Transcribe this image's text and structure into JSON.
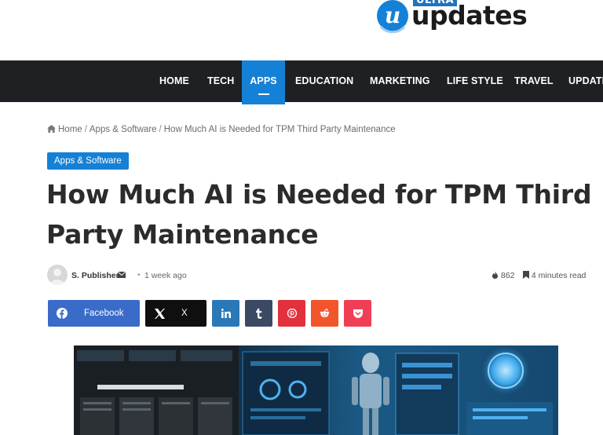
{
  "logo": {
    "ultra": "ULTRA",
    "updates": "updates",
    "mark": "u"
  },
  "nav": {
    "items": [
      {
        "label": "HOME",
        "active": false
      },
      {
        "label": "TECH",
        "active": false
      },
      {
        "label": "APPS",
        "active": true
      },
      {
        "label": "EDUCATION",
        "active": false
      },
      {
        "label": "MARKETING",
        "active": false
      },
      {
        "label": "LIFE STYLE",
        "active": false
      },
      {
        "label": "TRAVEL",
        "active": false
      },
      {
        "label": "UPDATE",
        "active": false
      }
    ]
  },
  "breadcrumb": {
    "home": "Home",
    "category": "Apps & Software",
    "current": "How Much AI is Needed for TPM Third Party Maintenance",
    "separator": "/"
  },
  "article": {
    "category_badge": "Apps & Software",
    "title": "How Much AI is Needed for TPM Third Party Maintenance",
    "author": "S. Publisher",
    "date": "1 week ago",
    "views": "862",
    "read_time": "4 minutes read"
  },
  "share": {
    "facebook": "Facebook",
    "x": "X"
  },
  "colors": {
    "accent": "#1581d6",
    "nav_bg": "#1f2024",
    "facebook": "#3a6bc9",
    "x": "#0f0f0f",
    "linkedin": "#2a78b8",
    "tumblr": "#3b4a63",
    "pinterest": "#e2313c",
    "reddit": "#f2542b",
    "pocket": "#ef3f56"
  },
  "icons": {
    "home": "home-icon",
    "mail": "envelope-icon",
    "views": "fire-icon",
    "read_time": "bookmark-icon",
    "facebook": "facebook-icon",
    "x": "x-icon",
    "linkedin": "linkedin-icon",
    "tumblr": "tumblr-icon",
    "pinterest": "pinterest-icon",
    "reddit": "reddit-icon",
    "pocket": "pocket-icon"
  }
}
